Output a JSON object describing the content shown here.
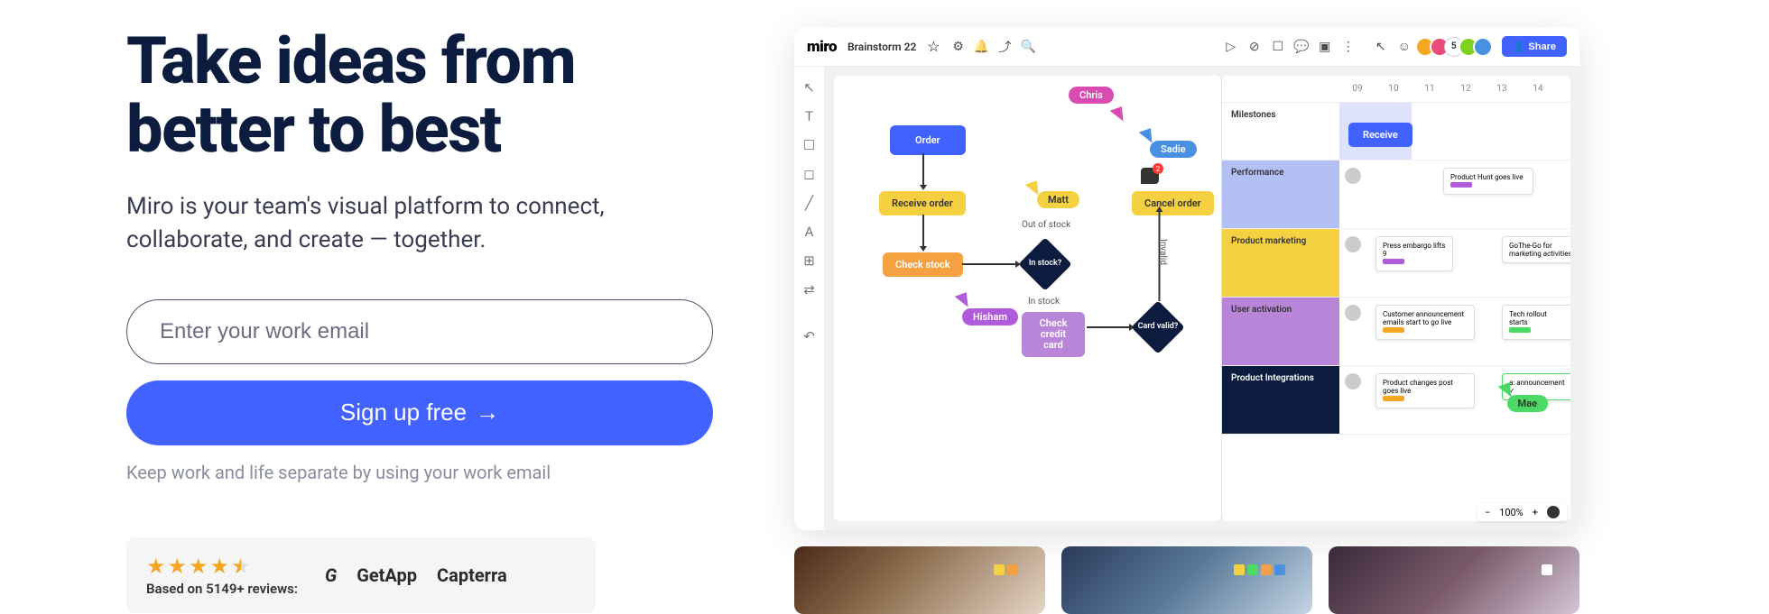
{
  "hero": {
    "title": "Take ideas from better to best",
    "subtitle": "Miro is your team's visual platform to connect, collaborate, and create — together.",
    "email_placeholder": "Enter your work email",
    "signup_label": "Sign up free",
    "helper": "Keep work and life separate by using your work email"
  },
  "reviews": {
    "text": "Based on 5149+ reviews:",
    "brands": [
      "G",
      "GetApp",
      "Capterra"
    ]
  },
  "app": {
    "logo": "miro",
    "board_name": "Brainstorm 22",
    "star": "☆",
    "share_label": "Share",
    "avatar_count": "5",
    "zoom": "100%"
  },
  "flowchart": {
    "order": "Order",
    "receive": "Receive order",
    "check_stock": "Check stock",
    "cancel": "Cancel order",
    "check_card": "Check credit card",
    "in_stock_q": "In stock?",
    "card_valid_q": "Card valid?",
    "out_of_stock": "Out of stock",
    "in_stock": "In stock",
    "invalid": "Invalid",
    "comment_badge": "2",
    "users": {
      "chris": "Chris",
      "sadie": "Sadie",
      "matt": "Matt",
      "hisham": "Hisham"
    }
  },
  "timeline": {
    "days": [
      "09",
      "10",
      "11",
      "12",
      "13",
      "14"
    ],
    "rows": {
      "milestones": "Milestones",
      "receive": "Receive",
      "performance": "Performance",
      "marketing": "Product marketing",
      "activation": "User activation",
      "integrations": "Product Integrations"
    },
    "cards": {
      "product_hunt": "Product Hunt goes live",
      "press": "Press embargo lifts 9",
      "guide": "GoThe-Go for marketing activities",
      "customer": "Customer announcement emails start to go live",
      "tech": "Tech rollout starts",
      "changes": "Product changes post goes live",
      "announce": "a: announcement ✓"
    },
    "mae": "Mae"
  }
}
